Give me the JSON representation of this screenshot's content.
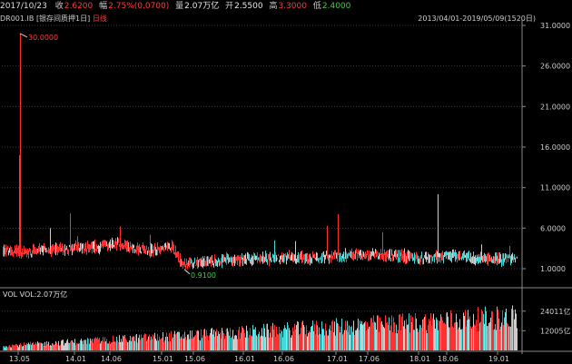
{
  "header": {
    "date": "2017/10/23",
    "close_label": "收",
    "close_value": "2.6200",
    "change_label": "幅",
    "change_value": "2.75%(0.0700)",
    "volume_label": "量",
    "volume_value": "2.07万亿",
    "open_label": "开",
    "open_value": "2.5500",
    "high_label": "高",
    "high_value": "3.3000",
    "low_label": "低",
    "low_value": "2.4000"
  },
  "subheader": {
    "code": "DR001.IB",
    "name": "[银存间质押1日]",
    "period": "日线"
  },
  "range_text": "2013/04/01-2019/05/09(1520日)",
  "chart_data": {
    "type": "candlestick",
    "y_ticks": [
      "31.0000",
      "26.0000",
      "21.0000",
      "16.0000",
      "11.0000",
      "6.0000",
      "1.0000"
    ],
    "y_range": [
      1,
      31
    ],
    "x_ticks": [
      "13.05",
      "14.01",
      "14.06",
      "15.01",
      "15.06",
      "16.01",
      "16.06",
      "17.01",
      "17.06",
      "18.01",
      "18.06",
      "19.01"
    ],
    "max_annotation": "30.0000",
    "min_annotation": "0.9100",
    "volume_label": "VOL VOL:2.07万亿",
    "volume_ticks": [
      "24011亿",
      "12005亿"
    ],
    "colors": {
      "up": "#ff3030",
      "down": "#45d8d8",
      "flat": "#cccccc"
    }
  }
}
